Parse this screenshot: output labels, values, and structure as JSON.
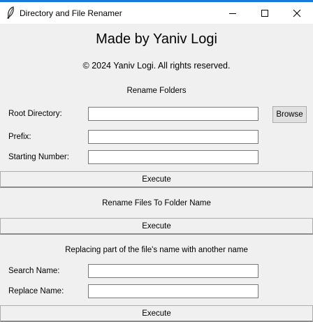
{
  "window": {
    "title": "Directory and File Renamer",
    "icon": "feather-icon",
    "controls": [
      "minimize-icon",
      "maximize-icon",
      "close-icon"
    ]
  },
  "header": {
    "title": "Made by Yaniv Logi",
    "copyright": "© 2024 Yaniv Logi. All rights reserved."
  },
  "rename_folders": {
    "heading": "Rename Folders",
    "root_directory_label": "Root Directory:",
    "root_directory_value": "",
    "browse_label": "Browse",
    "prefix_label": "Prefix:",
    "prefix_value": "",
    "starting_number_label": "Starting Number:",
    "starting_number_value": "",
    "execute_label": "Execute"
  },
  "rename_files": {
    "heading": "Rename Files To Folder Name",
    "execute_label": "Execute"
  },
  "replace_names": {
    "heading": "Replacing part of the file's name with another name",
    "search_label": "Search Name:",
    "search_value": "",
    "replace_label": "Replace Name:",
    "replace_value": "",
    "execute_label": "Execute"
  }
}
